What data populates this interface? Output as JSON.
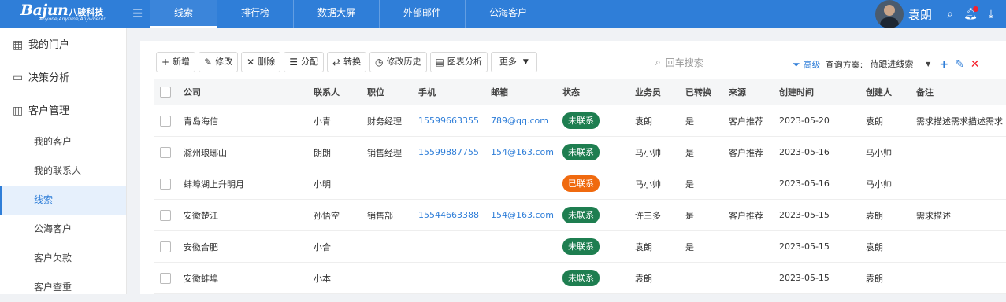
{
  "app": {
    "logo_brand": "Bajun",
    "logo_cn": "八骏科技",
    "logo_slogan": "Anyone,Anytime,Anywhere!"
  },
  "nav": [
    "线索",
    "排行榜",
    "数据大屏",
    "外部邮件",
    "公海客户"
  ],
  "user": {
    "name": "袁朗"
  },
  "sidebar": {
    "groups": [
      {
        "label": "我的门户",
        "icon": "grid-icon"
      },
      {
        "label": "决策分析",
        "icon": "monitor-chart-icon"
      },
      {
        "label": "客户管理",
        "icon": "building-icon"
      }
    ],
    "items": [
      "我的客户",
      "我的联系人",
      "线索",
      "公海客户",
      "客户欠款",
      "客户查重"
    ]
  },
  "toolbar": [
    {
      "label": "新增",
      "icon": "+"
    },
    {
      "label": "修改",
      "icon": "✎"
    },
    {
      "label": "删除",
      "icon": "✕"
    },
    {
      "label": "分配",
      "icon": "☰"
    },
    {
      "label": "转换",
      "icon": "⇄"
    },
    {
      "label": "修改历史",
      "icon": "◷"
    },
    {
      "label": "图表分析",
      "icon": "▤"
    },
    {
      "label": "更多",
      "icon": "▼"
    }
  ],
  "search": {
    "placeholder": "回车搜索"
  },
  "filter": {
    "advanced": "高级",
    "scheme_label": "查询方案:",
    "scheme_value": "待跟进线索"
  },
  "colors": {
    "primary": "#2f7ed8",
    "badge_green": "#1e7e50",
    "badge_orange": "#f06a0f",
    "add": "#2f7ed8",
    "edit": "#2f7ed8",
    "delete": "#f5222d"
  },
  "table": {
    "headers": [
      "公司",
      "联系人",
      "职位",
      "手机",
      "邮箱",
      "状态",
      "业务员",
      "已转换",
      "来源",
      "创建时间",
      "创建人",
      "备注"
    ],
    "rows": [
      [
        "青岛海信",
        "小青",
        "财务经理",
        "15599663355",
        "789@qq.com",
        "未联系",
        "袁朗",
        "是",
        "客户推荐",
        "2023-05-20",
        "袁朗",
        "需求描述需求描述需求"
      ],
      [
        "滁州琅琊山",
        "朗朗",
        "销售经理",
        "15599887755",
        "154@163.com",
        "未联系",
        "马小帅",
        "是",
        "客户推荐",
        "2023-05-16",
        "马小帅",
        ""
      ],
      [
        "蚌埠湖上升明月",
        "小明",
        "",
        "",
        "",
        "已联系",
        "马小帅",
        "是",
        "",
        "2023-05-16",
        "马小帅",
        ""
      ],
      [
        "安徽楚江",
        "孙悟空",
        "销售部",
        "15544663388",
        "154@163.com",
        "未联系",
        "许三多",
        "是",
        "客户推荐",
        "2023-05-15",
        "袁朗",
        "需求描述"
      ],
      [
        "安徽合肥",
        "小合",
        "",
        "",
        "",
        "未联系",
        "袁朗",
        "是",
        "",
        "2023-05-15",
        "袁朗",
        ""
      ],
      [
        "安徽蚌埠",
        "小本",
        "",
        "",
        "",
        "未联系",
        "袁朗",
        "",
        "",
        "2023-05-15",
        "袁朗",
        ""
      ]
    ]
  }
}
